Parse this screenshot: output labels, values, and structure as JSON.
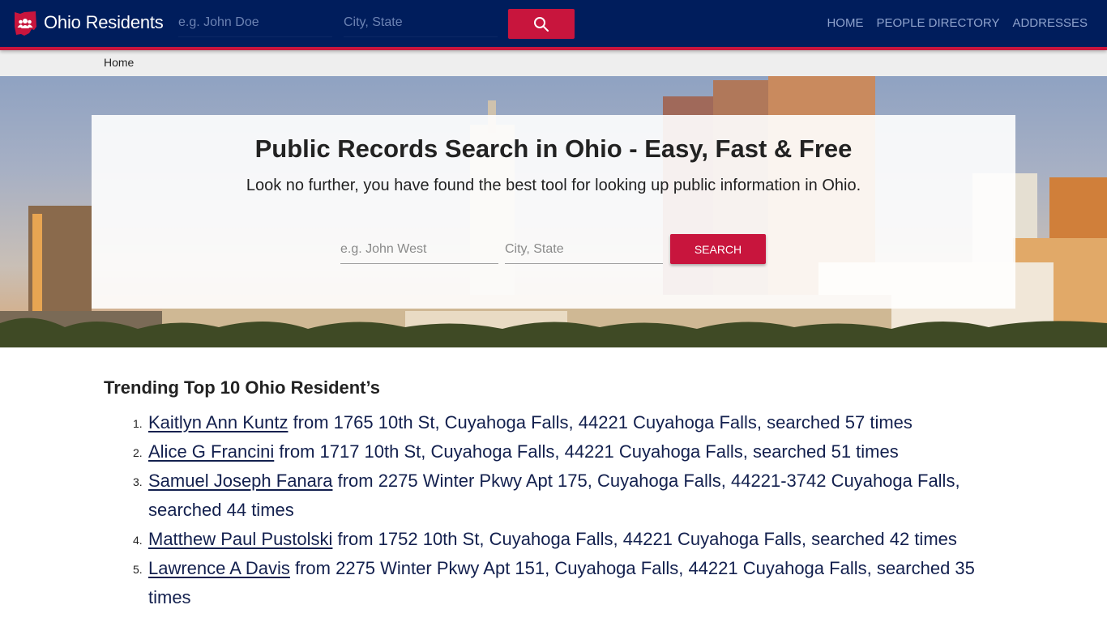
{
  "header": {
    "brand": "Ohio Residents",
    "logo_icon": "ohio-state-people-icon",
    "name_placeholder": "e.g. John Doe",
    "city_placeholder": "City, State",
    "search_icon": "search-icon",
    "nav": [
      {
        "label": "HOME"
      },
      {
        "label": "PEOPLE DIRECTORY"
      },
      {
        "label": "ADDRESSES"
      }
    ]
  },
  "breadcrumb": {
    "items": [
      {
        "label": "Home"
      }
    ]
  },
  "hero": {
    "title": "Public Records Search in Ohio - Easy, Fast & Free",
    "subtitle": "Look no further, you have found the best tool for looking up public information in Ohio.",
    "name_placeholder": "e.g. John West",
    "city_placeholder": "City, State",
    "search_label": "SEARCH"
  },
  "trending": {
    "title": "Trending Top 10 Ohio Resident’s",
    "items": [
      {
        "num": "1.",
        "name": "Kaitlyn Ann Kuntz",
        "detail": " from 1765 10th St, Cuyahoga Falls, 44221 Cuyahoga Falls, searched 57 times"
      },
      {
        "num": "2.",
        "name": "Alice G Francini",
        "detail": " from 1717 10th St, Cuyahoga Falls, 44221 Cuyahoga Falls, searched 51 times"
      },
      {
        "num": "3.",
        "name": "Samuel Joseph Fanara",
        "detail": " from 2275 Winter Pkwy Apt 175, Cuyahoga Falls, 44221-3742 Cuyahoga Falls, searched 44 times"
      },
      {
        "num": "4.",
        "name": "Matthew Paul Pustolski",
        "detail": " from 1752 10th St, Cuyahoga Falls, 44221 Cuyahoga Falls, searched 42 times"
      },
      {
        "num": "5.",
        "name": "Lawrence A Davis",
        "detail": " from 2275 Winter Pkwy Apt 151, Cuyahoga Falls, 44221 Cuyahoga Falls, searched 35 times"
      }
    ]
  },
  "colors": {
    "navbar": "#001d5c",
    "accent": "#c8153d",
    "link": "#13204e"
  }
}
